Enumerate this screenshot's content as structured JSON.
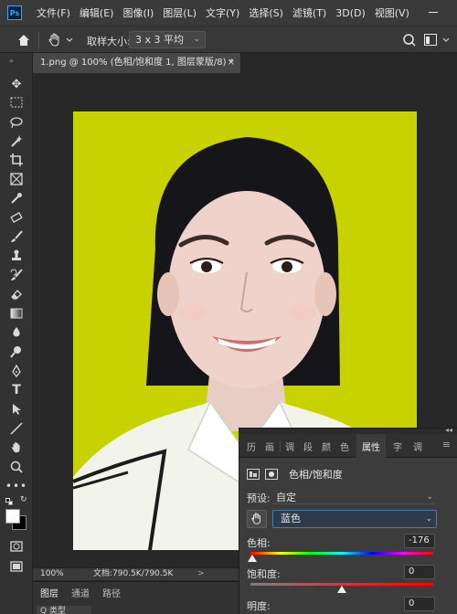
{
  "app": {
    "logo_text": "Ps",
    "menu": [
      "文件(F)",
      "编辑(E)",
      "图像(I)",
      "图层(L)",
      "文字(Y)",
      "选择(S)",
      "滤镜(T)",
      "3D(D)",
      "视图(V)"
    ]
  },
  "options_bar": {
    "sample_size_label": "取样大小:",
    "sample_size_value": "3 x 3 平均"
  },
  "document": {
    "tab_title": "1.png @ 100% (色相/饱和度 1, 图层蒙版/8) *",
    "tab_close": "×"
  },
  "status_bar": {
    "zoom": "100%",
    "doc_size": "文档:790.5K/790.5K",
    "arrow": ">"
  },
  "layers_panel": {
    "tabs": [
      "图层",
      "通道",
      "路径"
    ],
    "filter_label": "Q 类型"
  },
  "properties_panel": {
    "tabs": [
      "历",
      "画",
      "调",
      "段",
      "颜",
      "色",
      "属性",
      "字",
      "调"
    ],
    "active_tab": "属性",
    "adjustment_title": "色相/饱和度",
    "preset_label": "预设:",
    "preset_value": "自定",
    "channel_value": "蓝色",
    "hue_label": "色相:",
    "hue_value": "-176",
    "saturation_label": "饱和度:",
    "saturation_value": "0",
    "lightness_label": "明度:",
    "lightness_value": "0"
  },
  "colors": {
    "canvas_background": "#c8d200",
    "app_chrome": "#323232",
    "accent_blue": "#31a8ff"
  }
}
